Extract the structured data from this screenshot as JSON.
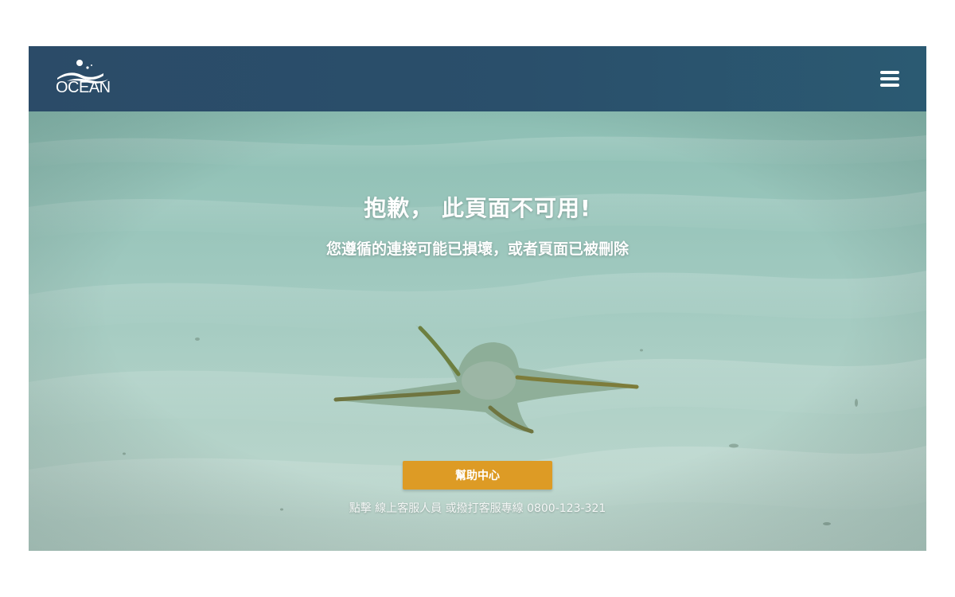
{
  "brand": {
    "logo_text": "OCEAN"
  },
  "header": {
    "menu_icon": "hamburger-menu-icon"
  },
  "error": {
    "title": "抱歉， 此頁面不可用!",
    "subtitle": "您遵循的連接可能已損壞，或者頁面已被刪除"
  },
  "actions": {
    "help_button_label": "幫助中心",
    "contact_prefix": "點擊",
    "contact_link_label": "線上客服人員",
    "contact_middle": "或撥打客服專線",
    "contact_phone": "0800-123-321"
  },
  "colors": {
    "header_bg": "#2a4d6b",
    "button_bg": "#dd9b25",
    "text": "#ffffff"
  }
}
